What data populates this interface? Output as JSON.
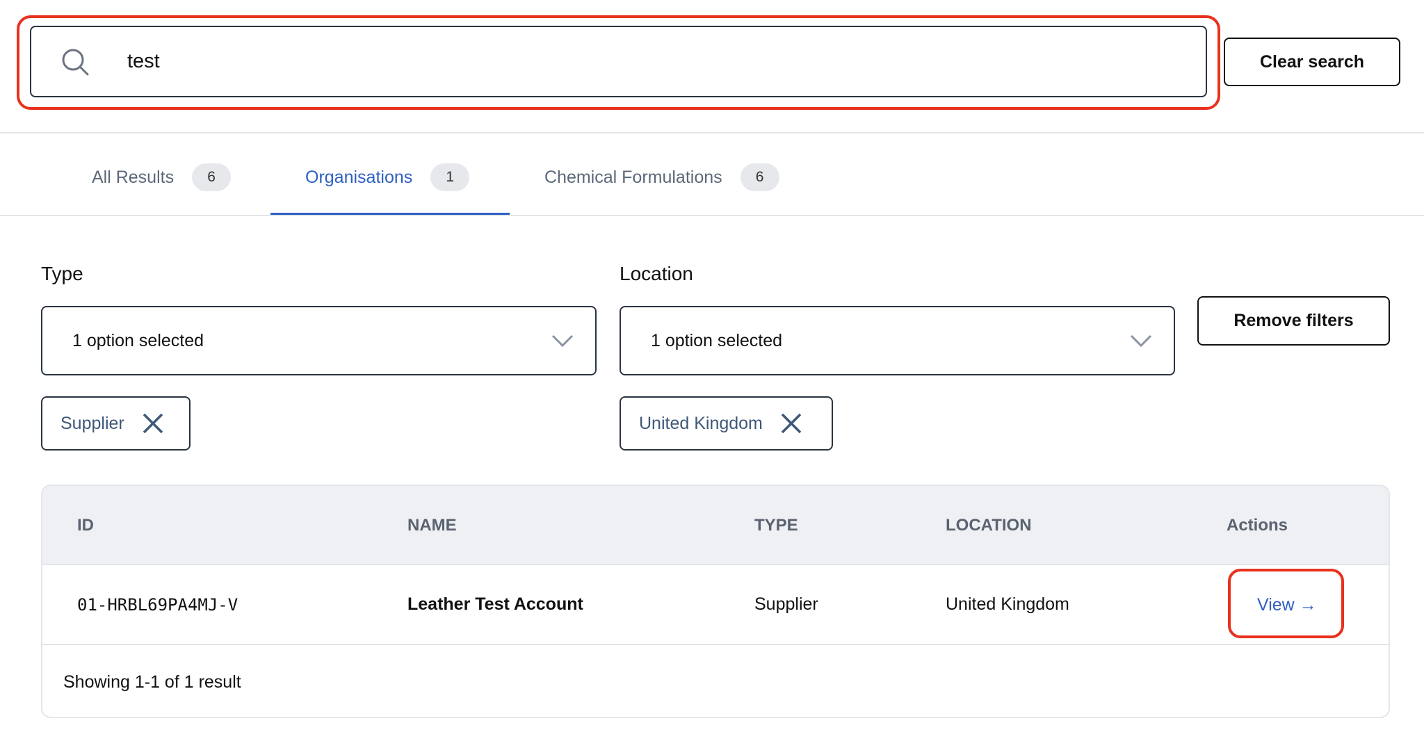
{
  "search": {
    "value": "test",
    "clear_label": "Clear search"
  },
  "tabs": [
    {
      "label": "All Results",
      "count": "6"
    },
    {
      "label": "Organisations",
      "count": "1"
    },
    {
      "label": "Chemical Formulations",
      "count": "6"
    }
  ],
  "active_tab": "Organisations",
  "filters": {
    "type": {
      "label": "Type",
      "selected": "1 option selected",
      "chip": "Supplier"
    },
    "location": {
      "label": "Location",
      "selected": "1 option selected",
      "chip": "United Kingdom"
    },
    "remove_label": "Remove filters"
  },
  "table": {
    "headers": [
      "ID",
      "NAME",
      "TYPE",
      "LOCATION",
      "Actions"
    ],
    "rows": [
      {
        "id": "01-HRBL69PA4MJ-V",
        "name": "Leather Test Account",
        "type": "Supplier",
        "location": "United Kingdom",
        "action": "View →"
      }
    ],
    "footer": "Showing 1-1 of 1 result"
  },
  "colors": {
    "accent": "#2f5fc4",
    "highlight": "#e8321e",
    "border": "#2a3441"
  },
  "icons": [
    "search-icon",
    "chevron-down-icon",
    "close-icon"
  ]
}
